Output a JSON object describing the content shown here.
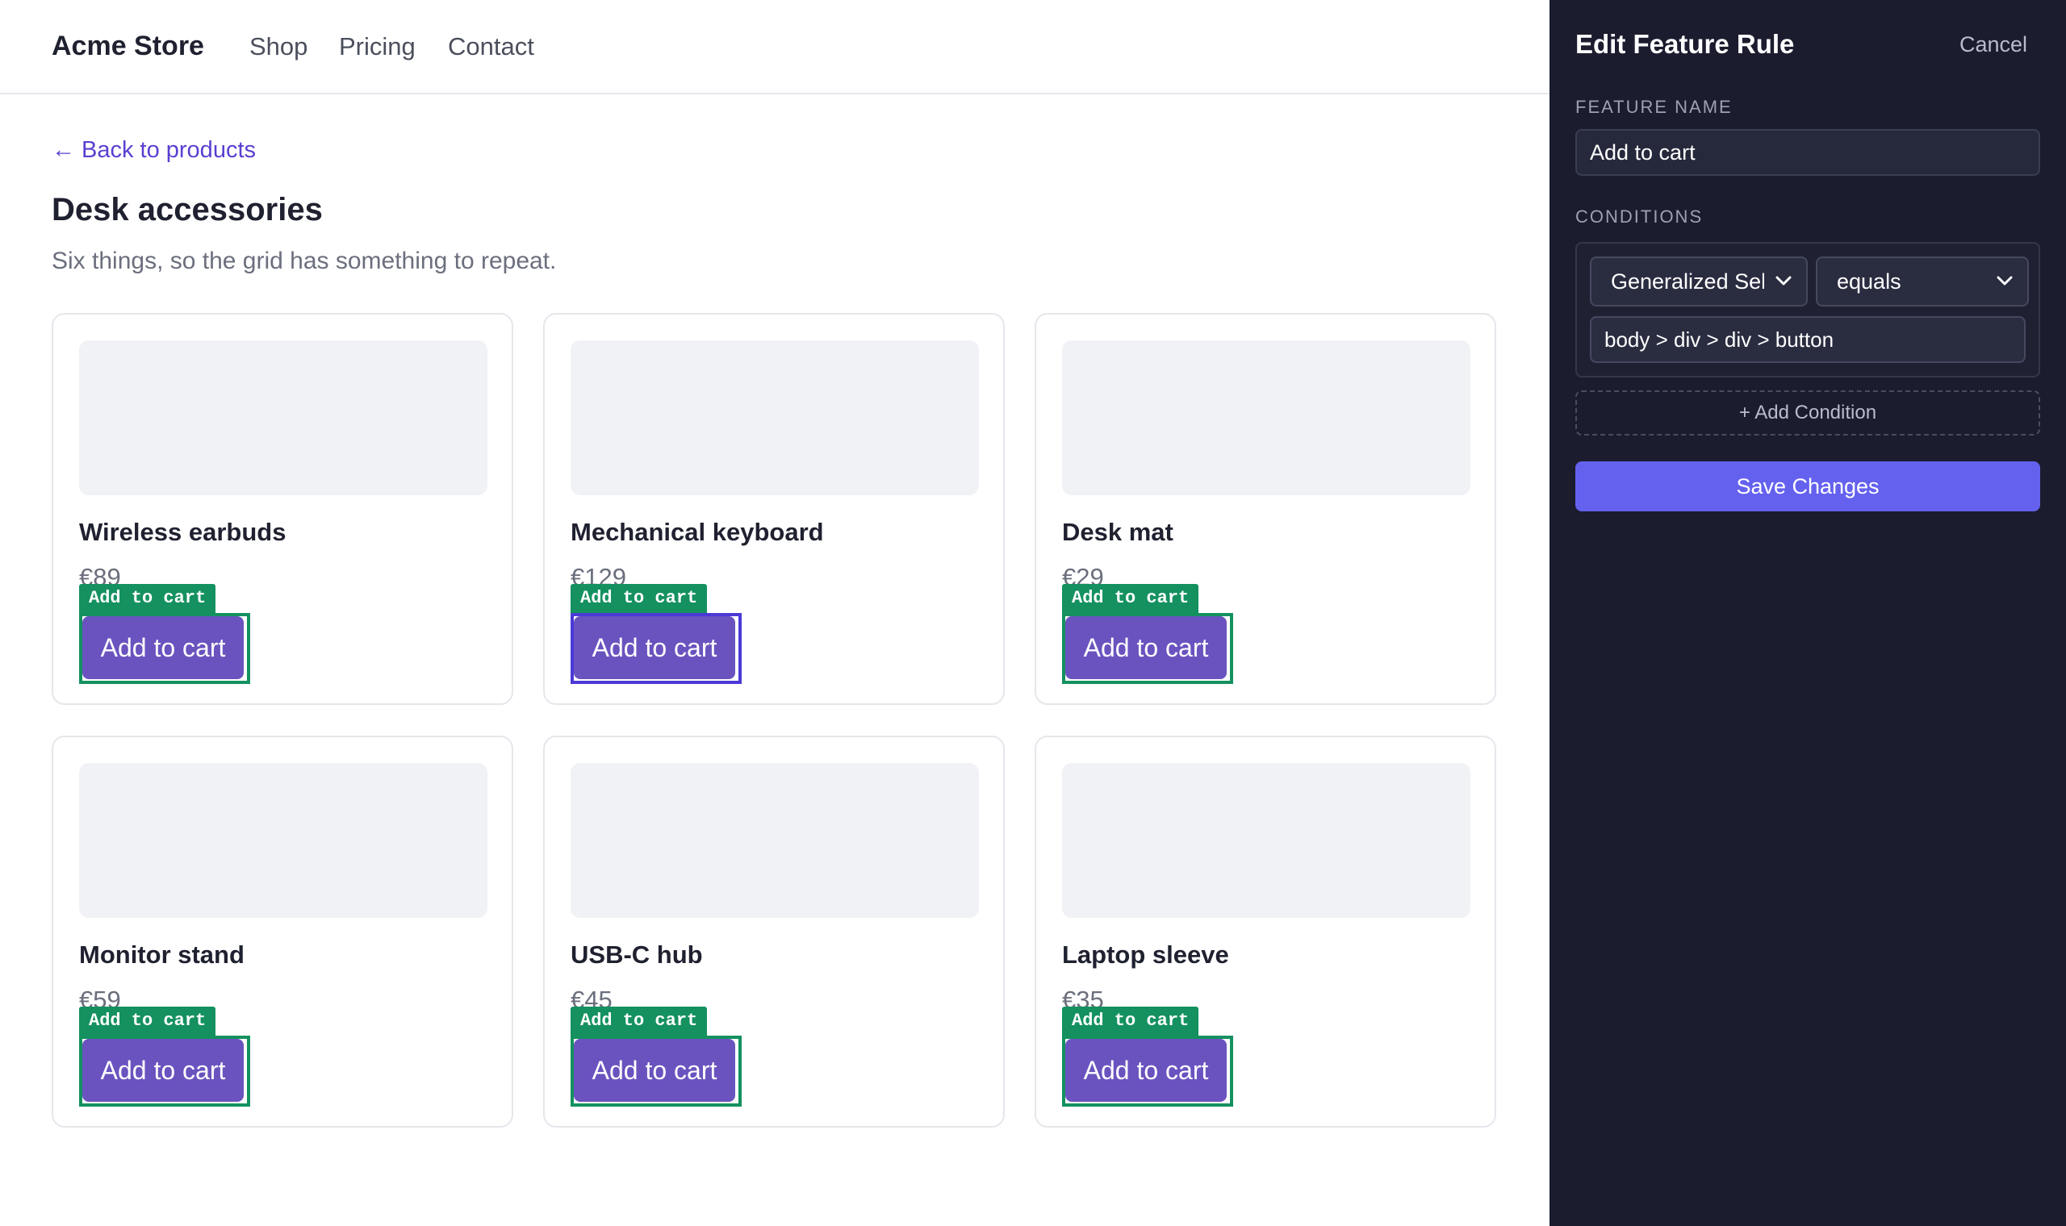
{
  "store": {
    "brand": "Acme Store",
    "nav": [
      "Shop",
      "Pricing",
      "Contact"
    ],
    "back_link": "Back to products",
    "title": "Desk accessories",
    "subtitle": "Six things, so the grid has something to repeat.",
    "products": [
      {
        "name": "Wireless earbuds",
        "price": "€89",
        "tag": "Add to cart",
        "button": "Add to cart"
      },
      {
        "name": "Mechanical keyboard",
        "price": "€129",
        "tag": "Add to cart",
        "button": "Add to cart"
      },
      {
        "name": "Desk mat",
        "price": "€29",
        "tag": "Add to cart",
        "button": "Add to cart"
      },
      {
        "name": "Monitor stand",
        "price": "€59",
        "tag": "Add to cart",
        "button": "Add to cart"
      },
      {
        "name": "USB-C hub",
        "price": "€45",
        "tag": "Add to cart",
        "button": "Add to cart"
      },
      {
        "name": "Laptop sleeve",
        "price": "€35",
        "tag": "Add to cart",
        "button": "Add to cart"
      }
    ]
  },
  "panel": {
    "title": "Edit Feature Rule",
    "cancel": "Cancel",
    "feature_name_label": "FEATURE NAME",
    "feature_name_value": "Add to cart",
    "conditions_label": "CONDITIONS",
    "condition": {
      "field": "Generalized Selector",
      "operator": "equals",
      "value": "body > div > div > button"
    },
    "add_condition": "+ Add Condition",
    "save": "Save Changes"
  },
  "colors": {
    "accent": "#6461ef",
    "button": "#6a53bf",
    "highlight": "#14915f",
    "selected_highlight": "#4b3ad7",
    "panel_bg": "#1b1c2e"
  }
}
